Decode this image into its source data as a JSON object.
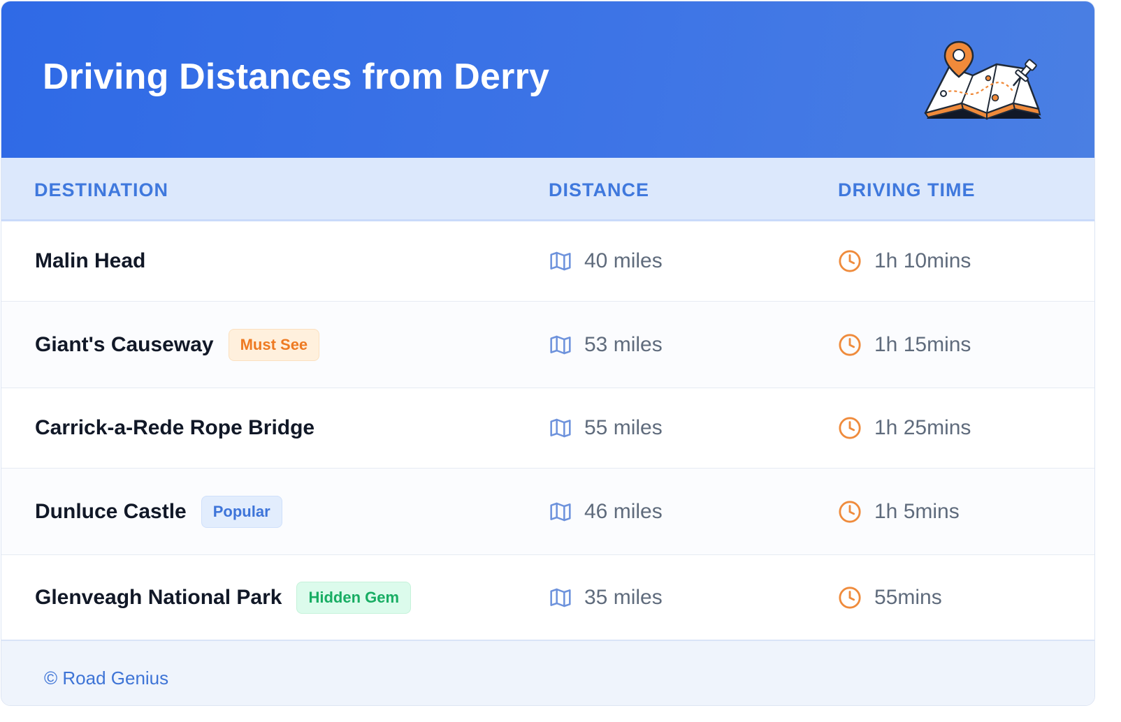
{
  "header": {
    "title": "Driving Distances from Derry",
    "illustration_icon": "map-with-pins-icon",
    "gradient_start": "#2f6ae6",
    "gradient_end": "#4a7fe3"
  },
  "table": {
    "columns": [
      "DESTINATION",
      "DISTANCE",
      "DRIVING TIME"
    ],
    "rows": [
      {
        "destination": "Malin Head",
        "badge": "",
        "distance": "40 miles",
        "time": "1h 10mins"
      },
      {
        "destination": "Giant's Causeway",
        "badge": "Must See",
        "badge_color": "orange",
        "distance": "53 miles",
        "time": "1h 15mins"
      },
      {
        "destination": "Carrick-a-Rede Rope Bridge",
        "badge": "",
        "distance": "55 miles",
        "time": "1h 25mins"
      },
      {
        "destination": "Dunluce Castle",
        "badge": "Popular",
        "badge_color": "blue",
        "distance": "46 miles",
        "time": "1h 5mins"
      },
      {
        "destination": "Glenveagh National Park",
        "badge": "Hidden Gem",
        "badge_color": "green",
        "distance": "35 miles",
        "time": "55mins"
      }
    ],
    "distance_icon": "map-icon",
    "time_icon": "clock-icon"
  },
  "footer": {
    "text": "© Road Genius"
  },
  "colors": {
    "accent_blue": "#3f78dd",
    "clock_orange": "#ef8b3c",
    "map_icon_blue": "#6d92dc",
    "orange_badge": "#ee7a22",
    "blue_badge": "#3d74d9",
    "green_badge": "#18ad63"
  }
}
